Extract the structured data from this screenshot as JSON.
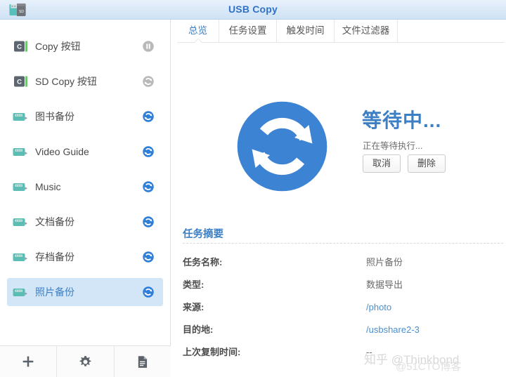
{
  "window": {
    "title": "USB Copy",
    "app_icon": "usb-sd-card-icon"
  },
  "sidebar": {
    "tasks": [
      {
        "label": "Copy 按钮",
        "icon": "copy-button-icon",
        "status_icon": "pause-icon",
        "selected": false
      },
      {
        "label": "SD Copy 按钮",
        "icon": "copy-button-icon",
        "status_icon": "sync-disabled-icon",
        "selected": false
      },
      {
        "label": "图书备份",
        "icon": "usb-device-icon",
        "status_icon": "sync-icon",
        "selected": false
      },
      {
        "label": "Video Guide",
        "icon": "usb-device-icon",
        "status_icon": "sync-icon",
        "selected": false
      },
      {
        "label": "Music",
        "icon": "usb-device-icon",
        "status_icon": "sync-icon",
        "selected": false
      },
      {
        "label": "文档备份",
        "icon": "usb-device-icon",
        "status_icon": "sync-icon",
        "selected": false
      },
      {
        "label": "存档备份",
        "icon": "usb-device-icon",
        "status_icon": "sync-icon",
        "selected": false
      },
      {
        "label": "照片备份",
        "icon": "usb-device-icon",
        "status_icon": "sync-icon",
        "selected": true
      }
    ],
    "toolbar": [
      {
        "icon": "plus-icon",
        "name": "add-task-button"
      },
      {
        "icon": "gear-icon",
        "name": "settings-button"
      },
      {
        "icon": "document-icon",
        "name": "log-button"
      }
    ]
  },
  "main": {
    "tabs": [
      {
        "label": "总览",
        "active": true
      },
      {
        "label": "任务设置",
        "active": false
      },
      {
        "label": "触发时间",
        "active": false
      },
      {
        "label": "文件过滤器",
        "active": false
      }
    ],
    "status": {
      "icon": "sync-status-icon",
      "title": "等待中...",
      "subtitle": "正在等待执行...",
      "buttons": [
        {
          "label": "取消",
          "name": "cancel-button"
        },
        {
          "label": "删除",
          "name": "delete-button"
        }
      ]
    },
    "summary": {
      "title": "任务摘要",
      "rows": [
        {
          "key": "任务名称:",
          "value": "照片备份",
          "link": false
        },
        {
          "key": "类型:",
          "value": "数据导出",
          "link": false
        },
        {
          "key": "来源:",
          "value": "/photo",
          "link": true
        },
        {
          "key": "目的地:",
          "value": "/usbshare2-3",
          "link": true
        },
        {
          "key": "上次复制时间:",
          "value": "--",
          "link": false
        }
      ]
    }
  },
  "watermarks": {
    "primary": "知乎 @Thinkbond",
    "secondary": "@51CTO博客"
  },
  "colors": {
    "accent_blue": "#3c7fc4",
    "link_blue": "#4a8fd0",
    "selected_row": "#d2e6f7",
    "device_teal": "#5bb8b0",
    "titlebar": "#dceaf8"
  }
}
